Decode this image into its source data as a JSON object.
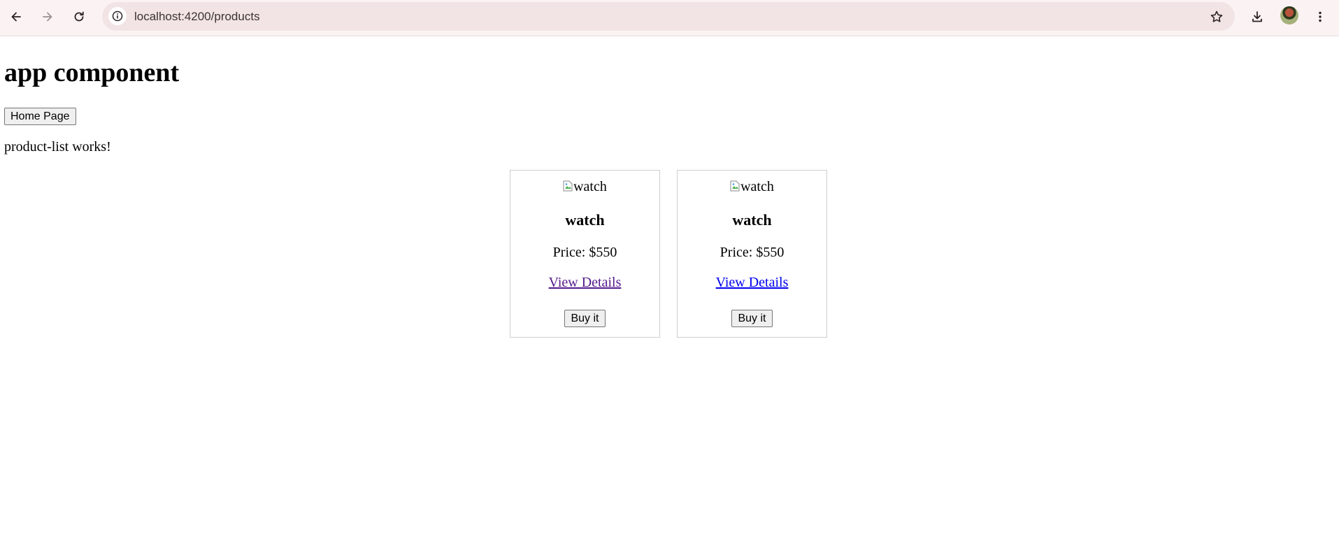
{
  "browser": {
    "url": "localhost:4200/products",
    "icons": {
      "back": "back-arrow-icon",
      "forward": "forward-arrow-icon",
      "reload": "reload-icon",
      "site_info": "info-icon",
      "bookmark": "star-icon",
      "downloads": "download-icon",
      "profile": "avatar",
      "menu": "kebab-menu-icon"
    }
  },
  "page": {
    "title": "app component",
    "home_button_label": "Home Page",
    "list_status": "product-list works!"
  },
  "products": [
    {
      "image_alt": "watch",
      "name": "watch",
      "price": "Price: $550",
      "details_link": "View Details",
      "link_state": "visited",
      "buy_label": "Buy it"
    },
    {
      "image_alt": "watch",
      "name": "watch",
      "price": "Price: $550",
      "details_link": "View Details",
      "link_state": "unvisited",
      "buy_label": "Buy it"
    }
  ],
  "colors": {
    "chrome_bg": "#fbf3f3",
    "omnibox_bg": "#f2e4e4",
    "visited_link": "#551a8b",
    "unvisited_link": "#0000ee",
    "card_border": "#cfcfcf"
  }
}
